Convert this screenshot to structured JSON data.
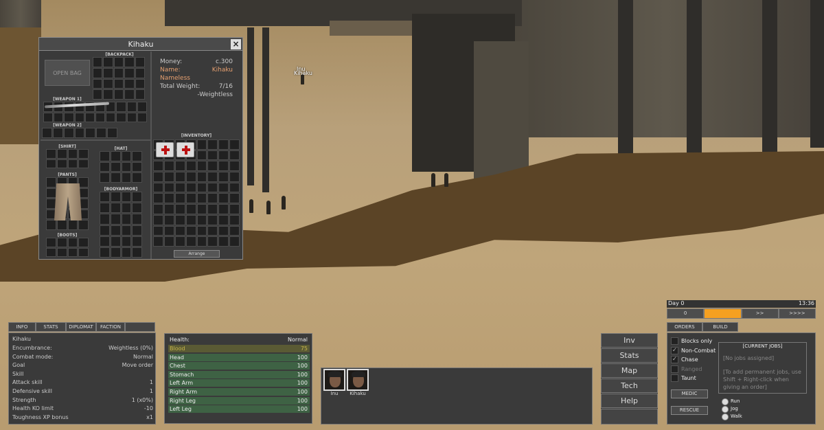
{
  "world": {
    "npc_labels": [
      "Inu",
      "Kihaku"
    ]
  },
  "inventory": {
    "title": "Kihaku",
    "open_bag": "OPEN BAG",
    "backpack": "[BACKPACK]",
    "weapon1": "[WEAPON 1]",
    "weapon2": "[WEAPON 2]",
    "shirt": "[SHIRT]",
    "hat": "[HAT]",
    "pants": "[PANTS]",
    "bodyarmor": "[BODYARMOR]",
    "boots": "[BOOTS]",
    "inventory": "[INVENTORY]",
    "arrange": "Arrange",
    "money_label": "Money:",
    "money_value": "c.300",
    "name_label": "Name:",
    "name_value": "Kihaku",
    "faction": "Nameless",
    "weight_label": "Total Weight:",
    "weight_value": "7/16",
    "weight_status": "-Weightless"
  },
  "char_tabs": [
    "INFO",
    "STATS",
    "DIPLOMAT",
    "FACTION"
  ],
  "char_info": {
    "name": "Kihaku",
    "rows": [
      {
        "k": "Encumbrance:",
        "v": "Weightless (0%)"
      },
      {
        "k": "Combat mode:",
        "v": "Normal"
      },
      {
        "k": "Goal",
        "v": "Move order"
      },
      {
        "k": "Skill",
        "v": ""
      },
      {
        "k": "Attack skill",
        "v": "1"
      },
      {
        "k": "Defensive skill",
        "v": "1"
      },
      {
        "k": "Strength",
        "v": "1 (x0%)"
      },
      {
        "k": "Health KO limit",
        "v": "-10"
      },
      {
        "k": "Toughness XP bonus",
        "v": "x1"
      }
    ]
  },
  "health": {
    "label": "Health:",
    "status": "Normal",
    "rows": [
      {
        "k": "Blood",
        "v": "75",
        "pct": 0.75
      },
      {
        "k": "Head",
        "v": "100",
        "pct": 1.0
      },
      {
        "k": "Chest",
        "v": "100",
        "pct": 1.0
      },
      {
        "k": "Stomach",
        "v": "100",
        "pct": 1.0
      },
      {
        "k": "Left Arm",
        "v": "100",
        "pct": 1.0
      },
      {
        "k": "Right Arm",
        "v": "100",
        "pct": 1.0
      },
      {
        "k": "Right Leg",
        "v": "100",
        "pct": 1.0
      },
      {
        "k": "Left Leg",
        "v": "100",
        "pct": 1.0
      }
    ]
  },
  "squad": [
    {
      "name": "Inu"
    },
    {
      "name": "Kihaku"
    }
  ],
  "menu": [
    "Inv",
    "Stats",
    "Map",
    "Tech",
    "Help"
  ],
  "time": {
    "day": "Day 0",
    "clock": "13:36",
    "speeds": [
      "0",
      "",
      ">>",
      ">>>>"
    ],
    "active_speed": 1
  },
  "jobs": {
    "tabs": [
      "ORDERS",
      "BUILD"
    ],
    "checks": [
      {
        "label": "Blocks only",
        "checked": false,
        "disabled": false
      },
      {
        "label": "Non-Combat",
        "checked": true,
        "disabled": false
      },
      {
        "label": "Chase",
        "checked": true,
        "disabled": false
      },
      {
        "label": "Ranged",
        "checked": false,
        "disabled": true
      },
      {
        "label": "Taunt",
        "checked": false,
        "disabled": false
      }
    ],
    "title": "[CURRENT JOBS]",
    "none": "[No jobs assigned]",
    "hint": "[To add permanent jobs, use Shift + Right-click when giving an order]",
    "medic": "MEDIC",
    "rescue": "RESCUE",
    "moves": [
      "Run",
      "Jog",
      "Walk"
    ]
  },
  "colors": {
    "accent_orange": "#f5a020",
    "name_orange": "#e7a070",
    "health_green": "#3e6244",
    "blood_yellow": "#c8b64a"
  }
}
